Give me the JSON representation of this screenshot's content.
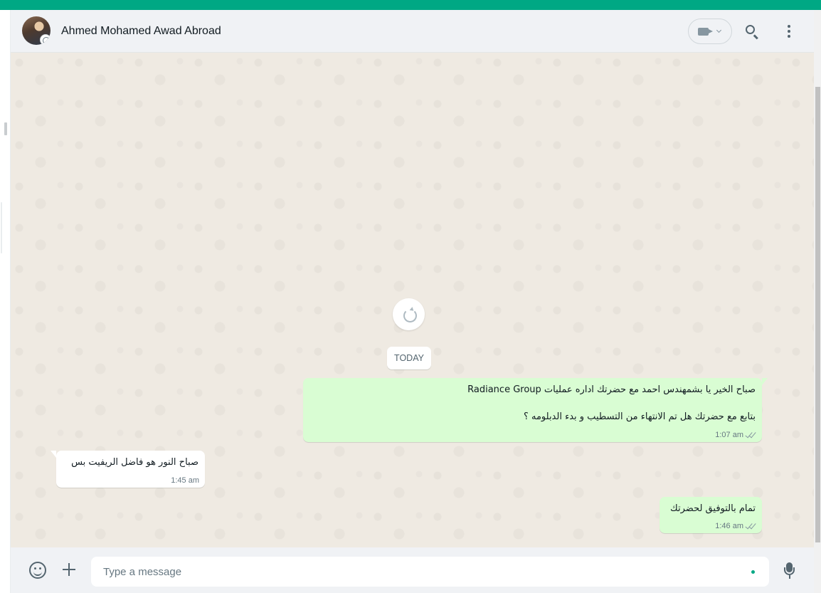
{
  "header": {
    "contact_name": "Ahmed Mohamed Awad Abroad",
    "avatar_icon": "contact-avatar",
    "video_icon": "video-camera-icon",
    "search_icon": "search-icon",
    "menu_icon": "more-vertical-icon"
  },
  "chat": {
    "date_label": "TODAY",
    "reload_icon": "refresh-icon",
    "messages": [
      {
        "direction": "out",
        "lines": [
          "صباح الخير يا بشمهندس  احمد مع  حضرتك اداره عمليات Radiance Group",
          "",
          "بتابع مع حضرتك هل تم الانتهاء من التسطيب و بدء الدبلومه ؟"
        ],
        "time": "1:07 am",
        "status": "read"
      },
      {
        "direction": "in",
        "lines": [
          "صباح النور هو فاضل الريفيت بس"
        ],
        "time": "1:45 am"
      },
      {
        "direction": "out",
        "lines": [
          "تمام بالتوفيق لحضرتك"
        ],
        "time": "1:46 am",
        "status": "read"
      }
    ]
  },
  "composer": {
    "placeholder": "Type a message",
    "value": "",
    "emoji_icon": "emoji-icon",
    "attach_icon": "plus-icon",
    "mic_icon": "microphone-icon"
  },
  "colors": {
    "accent": "#00a884",
    "outgoing_bubble": "#d9fdd3",
    "incoming_bubble": "#ffffff",
    "chat_background": "#efeae2",
    "header_background": "#f0f2f5"
  }
}
